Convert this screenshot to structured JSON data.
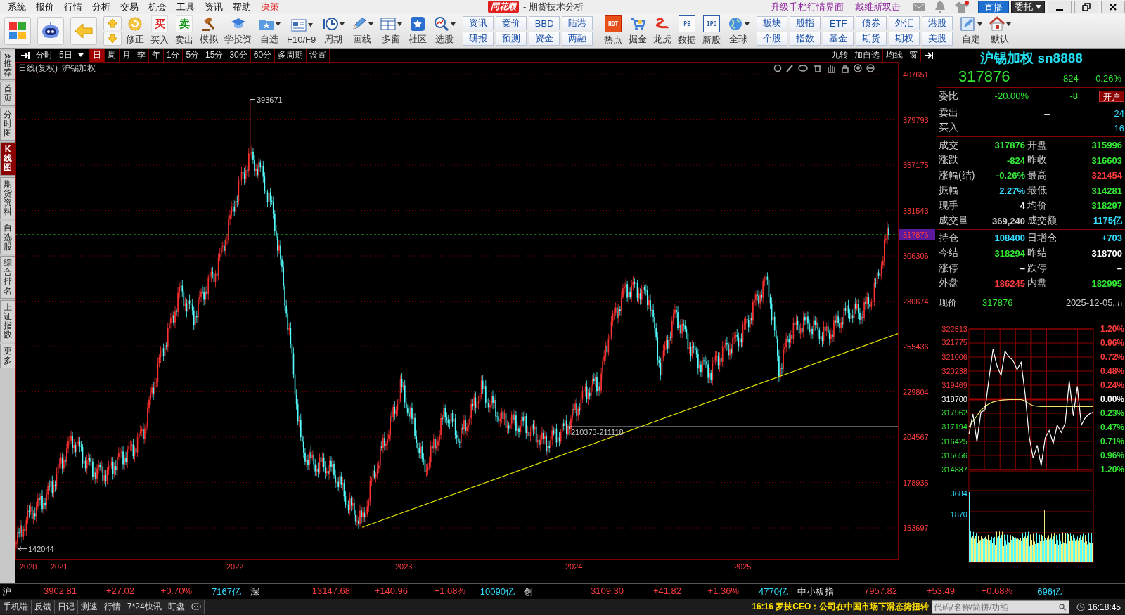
{
  "menu": {
    "items": [
      {
        "label": "系统",
        "highlight": false
      },
      {
        "label": "报价",
        "highlight": false
      },
      {
        "label": "行情",
        "highlight": false
      },
      {
        "label": "分析",
        "highlight": false
      },
      {
        "label": "交易",
        "highlight": false
      },
      {
        "label": "机会",
        "highlight": false
      },
      {
        "label": "工具",
        "highlight": false
      },
      {
        "label": "资讯",
        "highlight": false
      },
      {
        "label": "帮助",
        "highlight": false
      },
      {
        "label": "决策",
        "highlight": true
      }
    ]
  },
  "app_title": {
    "logo": "同花顺",
    "subtitle": "- 期货技术分析"
  },
  "top_links": [
    "升级千档行情界面",
    "戴维斯双击"
  ],
  "live_button": "直播",
  "order_button": "委托",
  "toolbar": {
    "left_buttons": [
      {
        "label": "修正",
        "dropdown": false
      },
      {
        "label": "买入",
        "glyph": "买",
        "dropdown": false
      },
      {
        "label": "卖出",
        "glyph": "卖",
        "dropdown": false
      },
      {
        "label": "模拟",
        "dropdown": false
      },
      {
        "label": "学投资",
        "dropdown": false
      },
      {
        "label": "自选",
        "dropdown": true
      },
      {
        "label": "F10/F9",
        "dropdown": true
      },
      {
        "label": "周期",
        "dropdown": true
      },
      {
        "label": "画线",
        "dropdown": true
      },
      {
        "label": "多窗",
        "dropdown": true
      },
      {
        "label": "社区",
        "dropdown": false
      },
      {
        "label": "选股",
        "dropdown": true
      }
    ],
    "quick_links": [
      {
        "top": "资讯",
        "bottom": "研报"
      },
      {
        "top": "竞价",
        "bottom": "预测"
      },
      {
        "top": "BBD",
        "bottom": "资金"
      },
      {
        "top": "陆港",
        "bottom": "两融"
      }
    ],
    "mid_buttons": [
      {
        "label": "热点",
        "glyph": "HOT",
        "dropdown": false
      },
      {
        "label": "掘金",
        "dropdown": false
      },
      {
        "label": "龙虎",
        "dropdown": false
      },
      {
        "label": "数据",
        "glyph": "PE",
        "dropdown": false
      },
      {
        "label": "新股",
        "glyph": "IPO",
        "dropdown": false
      },
      {
        "label": "全球",
        "dropdown": true
      }
    ],
    "market_links": [
      {
        "top": "板块",
        "bottom": "个股"
      },
      {
        "top": "股指",
        "bottom": "指数"
      },
      {
        "top": "ETF",
        "bottom": "基金"
      },
      {
        "top": "债券",
        "bottom": "期货"
      },
      {
        "top": "外汇",
        "bottom": "期权"
      },
      {
        "top": "港股",
        "bottom": "美股"
      }
    ],
    "right_buttons": [
      {
        "label": "自定",
        "dropdown": true
      },
      {
        "label": "默认",
        "dropdown": true
      }
    ]
  },
  "sidebar": {
    "items": [
      {
        "label": "推荐",
        "selected": false
      },
      {
        "label": "首页",
        "selected": false
      },
      {
        "label": "分时图",
        "selected": false
      },
      {
        "label": "K线图",
        "selected": true
      },
      {
        "label": "期货资料",
        "selected": false
      },
      {
        "label": "自选股",
        "selected": false
      },
      {
        "label": "综合排名",
        "selected": false
      },
      {
        "label": "上证指数",
        "selected": false
      },
      {
        "label": "更多",
        "selected": false
      }
    ]
  },
  "period_tabs": [
    {
      "label": "分时",
      "selected": false,
      "dropdown": false
    },
    {
      "label": "5日",
      "selected": false,
      "dropdown": true
    },
    {
      "label": "日",
      "selected": true,
      "dropdown": false
    },
    {
      "label": "周",
      "selected": false,
      "dropdown": false
    },
    {
      "label": "月",
      "selected": false,
      "dropdown": false
    },
    {
      "label": "季",
      "selected": false,
      "dropdown": false
    },
    {
      "label": "年",
      "selected": false,
      "dropdown": false
    },
    {
      "label": "1分",
      "selected": false,
      "dropdown": false
    },
    {
      "label": "5分",
      "selected": false,
      "dropdown": false
    },
    {
      "label": "15分",
      "selected": false,
      "dropdown": false
    },
    {
      "label": "30分",
      "selected": false,
      "dropdown": false
    },
    {
      "label": "60分",
      "selected": false,
      "dropdown": false
    },
    {
      "label": "多周期",
      "selected": false,
      "dropdown": false
    },
    {
      "label": "设置",
      "selected": false,
      "dropdown": false
    }
  ],
  "chart_tools": [
    "九转",
    "加自选",
    "均线",
    "窗"
  ],
  "chart": {
    "title": "日线(复权)",
    "symbol": "沪锡加权",
    "y_labels": [
      "407651",
      "379793",
      "357175",
      "331543",
      "306306",
      "280674",
      "255436",
      "229804",
      "204567",
      "178935",
      "153697"
    ],
    "current_price_tag": "317876",
    "high_label": "393671",
    "low_label": "142044",
    "range_label": "210373-211118",
    "x_labels": [
      "2020",
      "2021",
      "2022",
      "2023",
      "2024",
      "2025"
    ]
  },
  "quote": {
    "title": "沪锡加权 sn8888",
    "price": "317876",
    "change": "-824",
    "pct": "-0.26%",
    "ratio": {
      "label": "委比",
      "value": "-20.00%",
      "diff": "-8",
      "button": "开户"
    },
    "book": [
      {
        "label": "卖出",
        "price": "–",
        "volume": "24"
      },
      {
        "label": "买入",
        "price": "–",
        "volume": "16"
      }
    ],
    "stats": [
      {
        "left": {
          "label": "成交",
          "value": "317876",
          "color": "#33e833"
        },
        "right": {
          "label": "开盘",
          "value": "315996",
          "color": "#33e833"
        }
      },
      {
        "left": {
          "label": "涨跌",
          "value": "-824",
          "color": "#33e833"
        },
        "right": {
          "label": "昨收",
          "value": "316603",
          "color": "#33e833"
        }
      },
      {
        "left": {
          "label": "涨幅(结)",
          "value": "-0.26%",
          "color": "#33e833"
        },
        "right": {
          "label": "最高",
          "value": "321454",
          "color": "#ff3b3b"
        }
      },
      {
        "left": {
          "label": "振幅",
          "value": "2.27%",
          "color": "#33ddff"
        },
        "right": {
          "label": "最低",
          "value": "314281",
          "color": "#33e833"
        }
      },
      {
        "left": {
          "label": "现手",
          "value": "4",
          "color": "#ffffff"
        },
        "right": {
          "label": "均价",
          "value": "318297",
          "color": "#33e833"
        }
      },
      {
        "left": {
          "label": "成交量",
          "value": "369,240",
          "color": "#d0d0d0"
        },
        "right": {
          "label": "成交额",
          "value": "1175亿",
          "color": "#33ddff"
        }
      }
    ],
    "stats2": [
      {
        "left": {
          "label": "持仓",
          "value": "108400",
          "color": "#33ddff"
        },
        "right": {
          "label": "日增仓",
          "value": "+703",
          "color": "#33ddff"
        }
      },
      {
        "left": {
          "label": "今结",
          "value": "318294",
          "color": "#33e833"
        },
        "right": {
          "label": "昨结",
          "value": "318700",
          "color": "#ffffff"
        }
      },
      {
        "left": {
          "label": "涨停",
          "value": "–",
          "color": "#ffffff"
        },
        "right": {
          "label": "跌停",
          "value": "–",
          "color": "#ffffff"
        }
      },
      {
        "left": {
          "label": "外盘",
          "value": "186245",
          "color": "#ff3b3b"
        },
        "right": {
          "label": "内盘",
          "value": "182995",
          "color": "#33e833"
        }
      }
    ]
  },
  "intraday": {
    "header_label": "现价",
    "price": "317876",
    "date": "2025-12-05,五",
    "pct_labels": [
      {
        "text": "1.20%",
        "color": "#ff3b3b"
      },
      {
        "text": "0.96%",
        "color": "#ff3b3b"
      },
      {
        "text": "0.72%",
        "color": "#ff3b3b"
      },
      {
        "text": "0.48%",
        "color": "#ff3b3b"
      },
      {
        "text": "0.24%",
        "color": "#ff3b3b"
      },
      {
        "text": "0.00%",
        "color": "#ffffff"
      },
      {
        "text": "0.23%",
        "color": "#33e833"
      },
      {
        "text": "0.47%",
        "color": "#33e833"
      },
      {
        "text": "0.71%",
        "color": "#33e833"
      },
      {
        "text": "0.96%",
        "color": "#33e833"
      },
      {
        "text": "1.20%",
        "color": "#33e833"
      }
    ],
    "volume_labels": [
      "3684",
      "1870"
    ],
    "chart_data": {
      "type": "line",
      "ylim": [
        314887,
        322513
      ],
      "yticks": [
        {
          "value": 314887,
          "label": "314887"
        },
        {
          "value": 315656,
          "label": "315656"
        },
        {
          "value": 316425,
          "label": "316425"
        },
        {
          "value": 317194,
          "label": "317194"
        },
        {
          "value": 317962,
          "label": "317962"
        },
        {
          "value": 318700,
          "label": "318700"
        },
        {
          "value": 319469,
          "label": "319469"
        },
        {
          "value": 320238,
          "label": "320238"
        },
        {
          "value": 321006,
          "label": "321006"
        },
        {
          "value": 321775,
          "label": "321775"
        },
        {
          "value": 322513,
          "label": "322513"
        }
      ],
      "series": [
        {
          "color": "#ffffff",
          "values": [
            316800,
            317900,
            316400,
            318000,
            318100,
            319800,
            321400,
            320500,
            320000,
            321300,
            321000,
            320800,
            320300,
            320700,
            319000,
            316700,
            315500,
            316200,
            315100,
            316600,
            317000,
            316300,
            317300,
            316900,
            317400,
            319700,
            317800,
            319400,
            317300,
            317700,
            317900,
            318000
          ]
        },
        {
          "color": "#e8e870",
          "values": [
            317200,
            317500,
            317800,
            318100,
            318300,
            318450,
            318550,
            318600,
            318650,
            318670,
            318680,
            318690,
            318690,
            318690,
            318600,
            318450,
            318350,
            318320,
            318300,
            318300,
            318300,
            318300,
            318300,
            318300,
            318300,
            318300,
            318300,
            318300,
            318300,
            318300,
            318300,
            318300
          ]
        }
      ]
    }
  },
  "index_bar": [
    {
      "name": "沪",
      "value": "3902.81",
      "change": "+27.02",
      "pct": "+0.70%",
      "turnover": "7167亿"
    },
    {
      "name": "深",
      "value": "13147.68",
      "change": "+140.96",
      "pct": "+1.08%",
      "turnover": "10090亿"
    },
    {
      "name": "创",
      "value": "3109.30",
      "change": "+41.82",
      "pct": "+1.36%",
      "turnover": "4770亿"
    },
    {
      "name": "中小板指",
      "value": "7957.82",
      "change": "+53.49",
      "pct": "+0.68%",
      "turnover": "696亿"
    }
  ],
  "status_bar": {
    "links": [
      "手机端",
      "反馈",
      "日记",
      "测速",
      "行情",
      "7*24快讯",
      "盯盘"
    ],
    "news": "16:16 罗技CEO：公司在中国市场下滑态势扭转",
    "search": {
      "placeholder": "代码/名称/简拼/功能"
    },
    "time": "16:18:45"
  }
}
